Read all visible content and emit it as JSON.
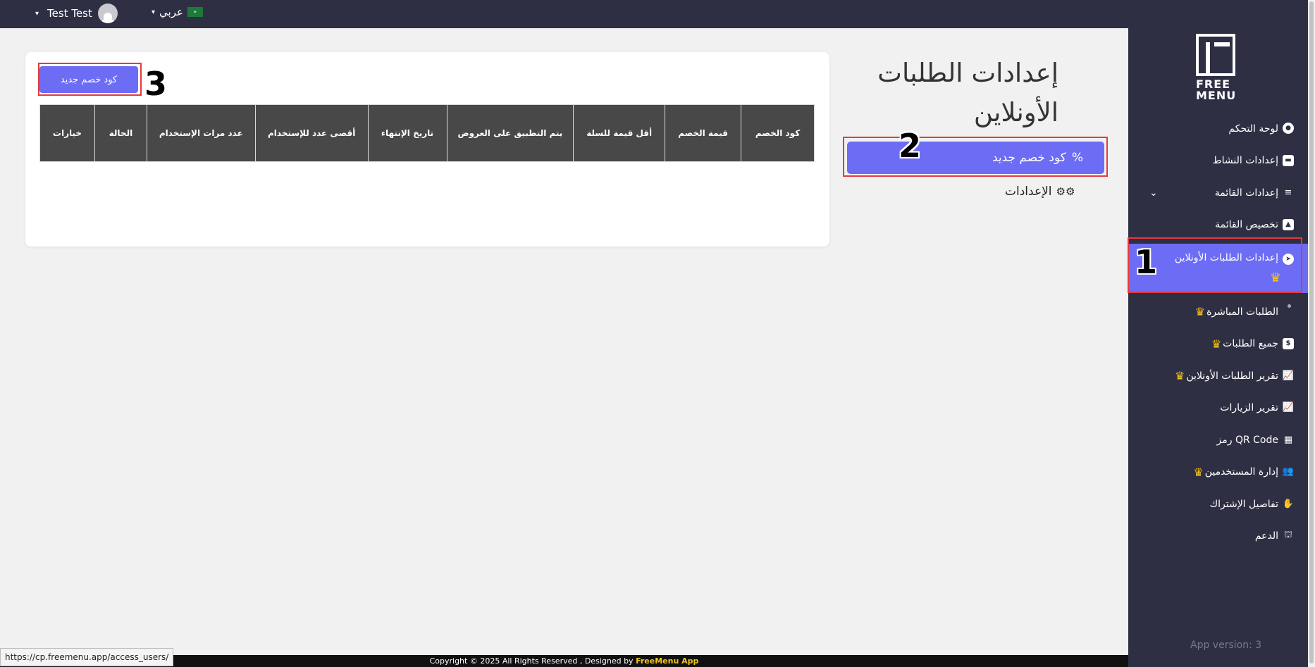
{
  "topbar": {
    "user_name": "Test Test",
    "language": "عربي"
  },
  "sidebar": {
    "logo_text": "FREE\nMENU",
    "items": [
      {
        "label": "لوحة التحكم"
      },
      {
        "label": "إعدادات النشاط"
      },
      {
        "label": "إعدادات القائمة"
      },
      {
        "label": "تخصيص القائمة"
      },
      {
        "label": "إعدادات الطلبات الأونلاين"
      },
      {
        "label": "الطلبات المباشرة"
      },
      {
        "label": "جميع الطلبات"
      },
      {
        "label": "تقرير الطلبات الأونلاين"
      },
      {
        "label": "تقرير الزيارات"
      },
      {
        "label": "رمز QR Code"
      },
      {
        "label": "إدارة المستخدمين"
      },
      {
        "label": "تفاصيل الإشتراك"
      },
      {
        "label": "الدعم"
      }
    ],
    "version": "App version: 3"
  },
  "main": {
    "title": "إعدادات الطلبات الأونلاين",
    "new_code_button": "كود خصم جديد",
    "settings_label": "الإعدادات",
    "card_new_button": "كود خصم جديد",
    "table_headers": [
      "كود الخصم",
      "قيمة الخصم",
      "أقل قيمة للسلة",
      "يتم التطبيق على العروض",
      "تاريخ الإنتهاء",
      "أقصى عدد للإستخدام",
      "عدد مرات الإستخدام",
      "الحالة",
      "خيارات"
    ]
  },
  "annotations": [
    "1",
    "2",
    "3"
  ],
  "footer": {
    "copyright": "Copyright © 2025 All Rights Reserved , Designed by",
    "brand": "FreeMenu App"
  },
  "status_url": "https://cp.freemenu.app/access_users/",
  "colors": {
    "sidebar_bg": "#2f2f44",
    "accent": "#6c6cf5",
    "crown": "#f5c518",
    "highlight": "#e53940"
  }
}
